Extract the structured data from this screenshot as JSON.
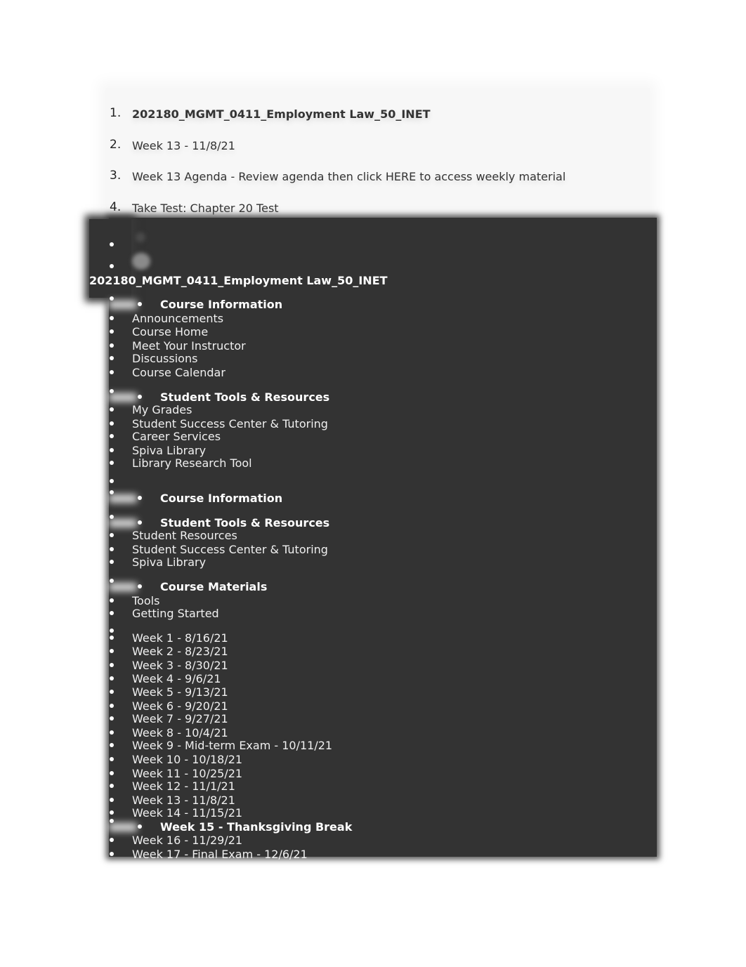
{
  "breadcrumb": [
    {
      "index": "1.",
      "label": "202180_MGMT_0411_Employment Law_50_INET",
      "bold": true
    },
    {
      "index": "2.",
      "label": "Week 13 - 11/8/21",
      "bold": false
    },
    {
      "index": "3.",
      "label": "Week 13 Agenda - Review agenda then click HERE to access weekly material",
      "bold": false
    },
    {
      "index": "4.",
      "label": "Take Test: Chapter 20 Test",
      "bold": false
    }
  ],
  "nav": {
    "course_title": "202180_MGMT_0411_Employment Law_50_INET",
    "sections": [
      {
        "heading": "Course Information",
        "items": [
          "Announcements",
          "Course Home",
          "Meet Your Instructor",
          "Discussions",
          "Course Calendar"
        ]
      },
      {
        "heading": "Student Tools & Resources",
        "items": [
          "My Grades",
          "Student Success Center & Tutoring",
          "Career Services",
          "Spiva Library",
          "Library Research Tool"
        ]
      },
      {
        "heading": "Course Information",
        "items": []
      },
      {
        "heading": "Student Tools & Resources",
        "items": [
          "Student Resources",
          "Student Success Center & Tutoring",
          "Spiva Library"
        ]
      },
      {
        "heading": "Course Materials",
        "items": [
          "Tools",
          "Getting Started"
        ]
      }
    ],
    "weeks": [
      "Week 1 - 8/16/21",
      "Week 2 - 8/23/21",
      "Week 3 - 8/30/21",
      "Week 4 - 9/6/21",
      "Week 5 - 9/13/21",
      "Week 6 - 9/20/21",
      "Week 7 - 9/27/21",
      "Week 8 - 10/4/21",
      "Week 9 - Mid-term Exam - 10/11/21",
      "Week 10 - 10/18/21",
      "Week 11 - 10/25/21",
      "Week 12 - 11/1/21",
      "Week 13 - 11/8/21",
      "Week 14 - 11/15/21"
    ],
    "week15_heading": "Week 15 - Thanksgiving Break",
    "final_weeks": [
      "Week 16 - 11/29/21",
      "Week 17 - Final Exam - 12/6/21"
    ]
  }
}
